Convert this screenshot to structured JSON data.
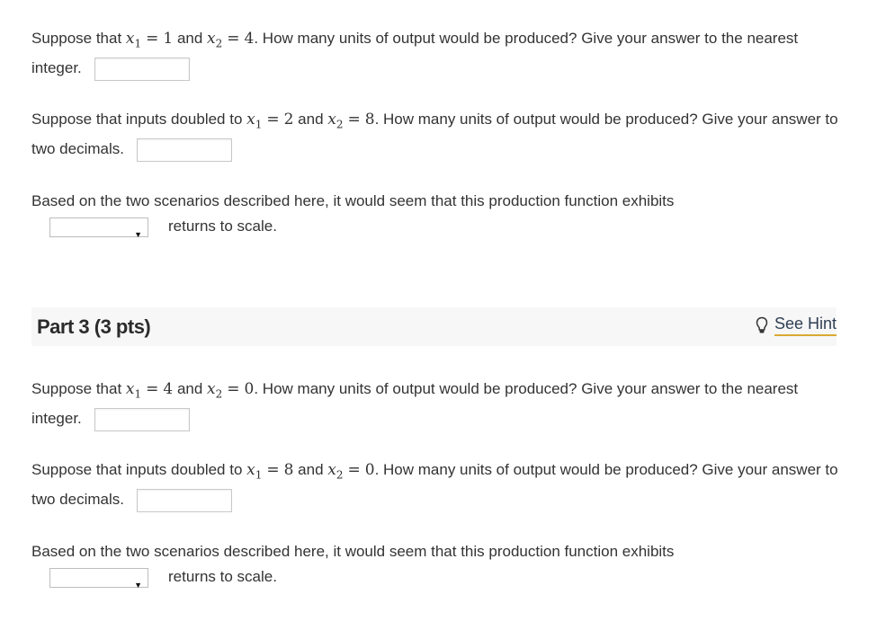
{
  "part2": {
    "q1": {
      "prefix": "Suppose that ",
      "x1_var": "x",
      "x1_sub": "1",
      "equals": "=",
      "x1_val": "1",
      "and": " and ",
      "x2_var": "x",
      "x2_sub": "2",
      "x2_val": "4",
      "suffix": ". How many units of output would be produced? Give your answer to the nearest integer.",
      "answer": ""
    },
    "q2": {
      "prefix": "Suppose that inputs doubled to ",
      "x1_var": "x",
      "x1_sub": "1",
      "equals": "=",
      "x1_val": "2",
      "and": " and ",
      "x2_var": "x",
      "x2_sub": "2",
      "x2_val": "8",
      "suffix": ". How many units of output would be produced? Give your answer to two decimals.",
      "answer": ""
    },
    "q3": {
      "text": "Based on the two scenarios described here, it would seem that this production function exhibits",
      "select_value": "",
      "select_caret": "▼",
      "after_select": "returns to scale."
    }
  },
  "part3": {
    "title": "Part 3 (3 pts)",
    "hint_icon": "lightbulb-icon",
    "hint_label": "See Hint",
    "hint_color": "#d9a933",
    "q1": {
      "prefix": "Suppose that ",
      "x1_var": "x",
      "x1_sub": "1",
      "equals": "=",
      "x1_val": "4",
      "and": " and ",
      "x2_var": "x",
      "x2_sub": "2",
      "x2_val": "0",
      "suffix": ". How many units of output would be produced? Give your answer to the nearest integer.",
      "answer": ""
    },
    "q2": {
      "prefix": "Suppose that inputs doubled to ",
      "x1_var": "x",
      "x1_sub": "1",
      "equals": "=",
      "x1_val": "8",
      "and": " and ",
      "x2_var": "x",
      "x2_sub": "2",
      "x2_val": "0",
      "suffix": ". How many units of output would be produced? Give your answer to two decimals.",
      "answer": ""
    },
    "q3": {
      "text": "Based on the two scenarios described here, it would seem that this production function exhibits",
      "select_value": "",
      "select_caret": "▼",
      "after_select": "returns to scale."
    }
  }
}
